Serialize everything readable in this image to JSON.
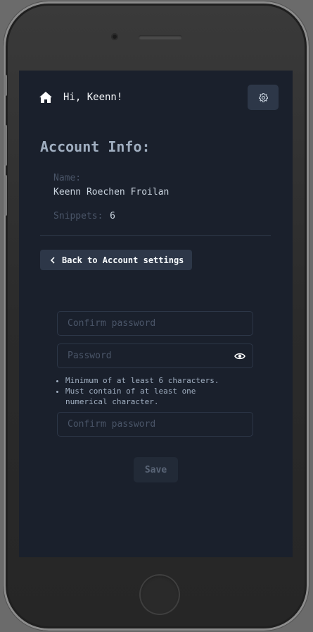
{
  "header": {
    "greeting": "Hi, Keenn!",
    "home_icon": "home-icon",
    "settings_icon": "gear-icon"
  },
  "account": {
    "title": "Account Info:",
    "name_label": "Name:",
    "name_value": "Keenn Roechen Froilan",
    "snippets_label": "Snippets:",
    "snippets_value": "6"
  },
  "nav": {
    "back_label": "Back to Account settings"
  },
  "form": {
    "confirm_password_1": {
      "placeholder": "Confirm password",
      "value": ""
    },
    "password": {
      "placeholder": "Password",
      "value": ""
    },
    "rules": [
      "Minimum of at least 6 characters.",
      "Must contain of at least one numerical character."
    ],
    "confirm_password_2": {
      "placeholder": "Confirm password",
      "value": ""
    },
    "save_label": "Save"
  }
}
